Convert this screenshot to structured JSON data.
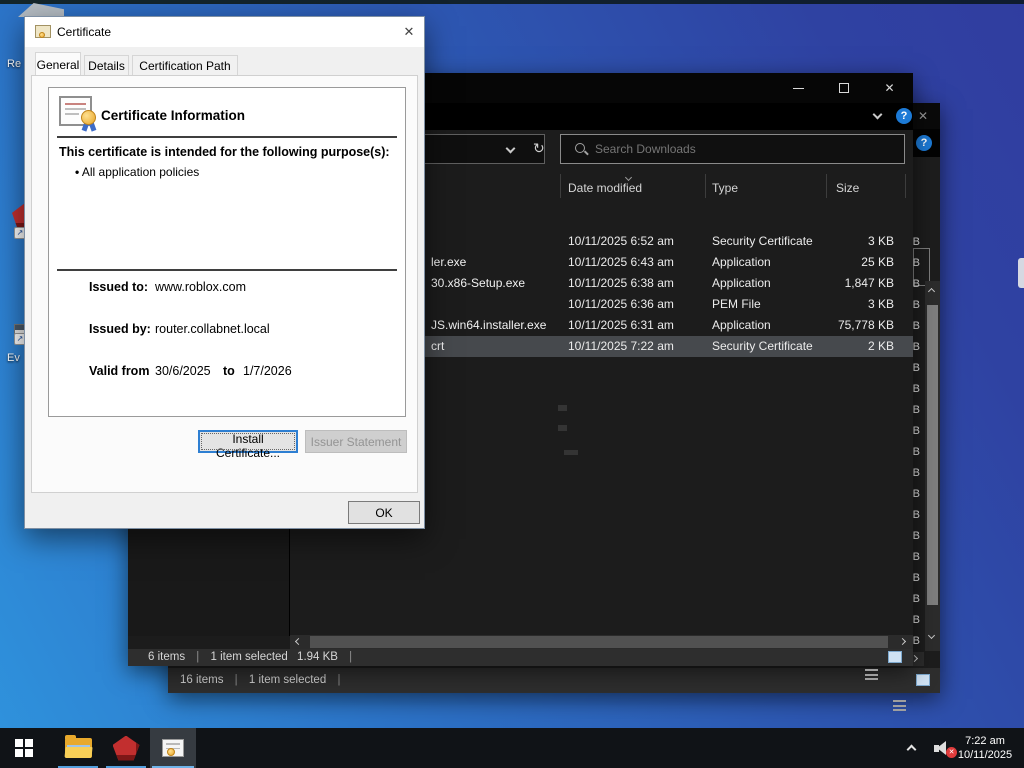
{
  "ui": {
    "pipe": "|",
    "bullet": "•"
  },
  "icons": {
    "close": "✕",
    "help": "?",
    "refresh": "↻",
    "shortcut_arrow": "↗",
    "mute_x": "✕"
  },
  "colors": {
    "accent": "#0078d7",
    "desktop_blue": "#2d57b2",
    "selection_gray": "#46494d",
    "taskbar_underline": "#539fdd"
  },
  "desktop": {
    "icon_label_top": "Re",
    "icon_label_bottom": "Ev"
  },
  "certificate_dialog": {
    "title": "Certificate",
    "tabs": [
      {
        "label": "General",
        "active": true
      },
      {
        "label": "Details",
        "active": false
      },
      {
        "label": "Certification Path",
        "active": false
      }
    ],
    "info_heading": "Certificate Information",
    "purpose_heading": "This certificate is intended for the following purpose(s):",
    "purpose_item": "All application policies",
    "fields": {
      "issued_to_label": "Issued to:",
      "issued_to_value": "www.roblox.com",
      "issued_by_label": "Issued by:",
      "issued_by_value": "router.collabnet.local",
      "valid_from_label": "Valid from",
      "valid_from_value": "30/6/2025",
      "valid_to_label": "to",
      "valid_to_value": "1/7/2026"
    },
    "buttons": {
      "install": "Install Certificate...",
      "issuer_statement": "Issuer Statement",
      "ok": "OK"
    }
  },
  "explorer": {
    "search_placeholder": "Search Downloads",
    "columns": {
      "date": "Date modified",
      "type": "Type",
      "size": "Size"
    },
    "files": [
      {
        "name": "",
        "date_modified": "10/11/2025 6:52 am",
        "type": "Security Certificate",
        "size": "3 KB"
      },
      {
        "name": "ler.exe",
        "date_modified": "10/11/2025 6:43 am",
        "type": "Application",
        "size": "25 KB"
      },
      {
        "name": "30.x86-Setup.exe",
        "date_modified": "10/11/2025 6:38 am",
        "type": "Application",
        "size": "1,847 KB"
      },
      {
        "name": "",
        "date_modified": "10/11/2025 6:36 am",
        "type": "PEM File",
        "size": "3 KB"
      },
      {
        "name": "JS.win64.installer.exe",
        "date_modified": "10/11/2025 6:31 am",
        "type": "Application",
        "size": "75,778 KB"
      },
      {
        "name": "crt",
        "date_modified": "10/11/2025 7:22 am",
        "type": "Security Certificate",
        "size": "2 KB",
        "selected": true
      }
    ],
    "status": {
      "items": "6 items",
      "selection": "1 item selected",
      "selection_size": "1.94 KB"
    }
  },
  "explorer_back": {
    "status": {
      "items": "16 items",
      "selection": "1 item selected"
    },
    "size_fragments": [
      "KB",
      "KB",
      "KB",
      "KB",
      "KB",
      "KB",
      "KB",
      "KB",
      "KB",
      "KB",
      "KB",
      "KB",
      "KB",
      "KB",
      "KB",
      "KB",
      "KB",
      "KB",
      "KB",
      "KB"
    ]
  },
  "taskbar": {
    "clock": {
      "time": "7:22 am",
      "date": "10/11/2025"
    }
  }
}
